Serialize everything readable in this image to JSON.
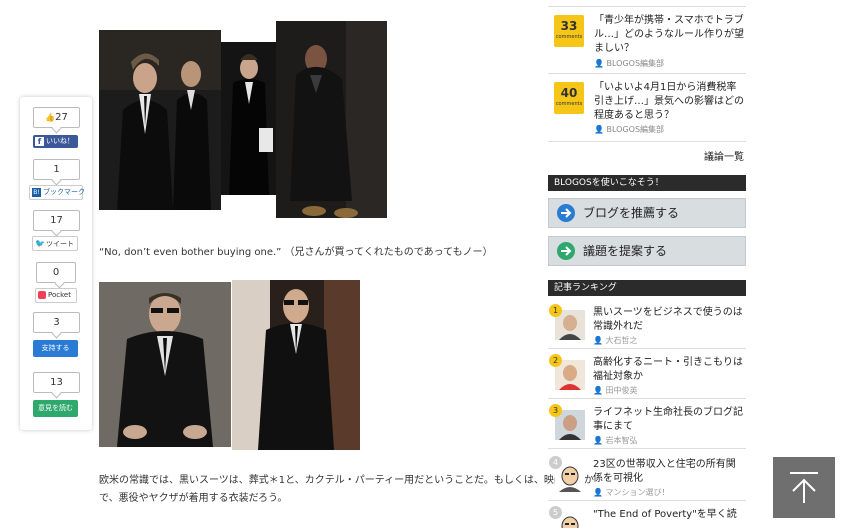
{
  "share": {
    "facebook": {
      "count": "27",
      "label": "いいね！"
    },
    "hatena": {
      "count": "1",
      "label": "ブックマーク"
    },
    "twitter": {
      "count": "17",
      "label": "ツイート"
    },
    "pocket": {
      "count": "0",
      "label": "Pocket"
    },
    "support": {
      "count": "3",
      "label": "支持する"
    },
    "opinion": {
      "count": "13",
      "label": "意見を読む"
    }
  },
  "article": {
    "quote": "“No, don’t even bother buying one.” （兄さんが買ってくれたものであってもノー）",
    "body_line1": "欧米の常識では、黒いスーツは、葬式＊1と、カクテル・パーティー用だということだ。もしくは、映画のなか",
    "body_line2": "で、悪役やヤクザが着用する衣装だろう。"
  },
  "sidebar": {
    "comments": [
      {
        "count": "33",
        "unit": "comments",
        "title": "「青少年が携帯・スマホでトラブル…」どのようなルール作りが望ましい？",
        "author": "BLOGOS編集部"
      },
      {
        "count": "40",
        "unit": "comments",
        "title": "「いよいよ4月1日から消費税率引き上げ…」景気への影響はどの程度あると思う？",
        "author": "BLOGOS編集部"
      }
    ],
    "discussion_list_link": "議論一覧",
    "use_header": "BLOGOSを使いこなそう！",
    "recommend_button": "ブログを推薦する",
    "propose_button": "議題を提案する",
    "ranking_header": "記事ランキング",
    "ranking": [
      {
        "rank": "1",
        "title": "黒いスーツをビジネスで使うのは常識外れだ",
        "author": "大石哲之"
      },
      {
        "rank": "2",
        "title": "高齢化するニート・引きこもりは福祉対象か",
        "author": "田中俊英"
      },
      {
        "rank": "3",
        "title": "ライフネット生命社長のブログ記事にまて",
        "author": "岩本智弘"
      },
      {
        "rank": "4",
        "title": "23区の世帯収入と住宅の所有関係を可視化",
        "author": "マンション選び！"
      },
      {
        "rank": "5",
        "title": "\"The End of Poverty\"を早く読",
        "author": ""
      }
    ]
  },
  "colors": {
    "accent_yellow": "#f5c518",
    "dark_header": "#2b2b2b",
    "button_gray": "#d8dde0",
    "to_top": "#6f6f6f"
  }
}
